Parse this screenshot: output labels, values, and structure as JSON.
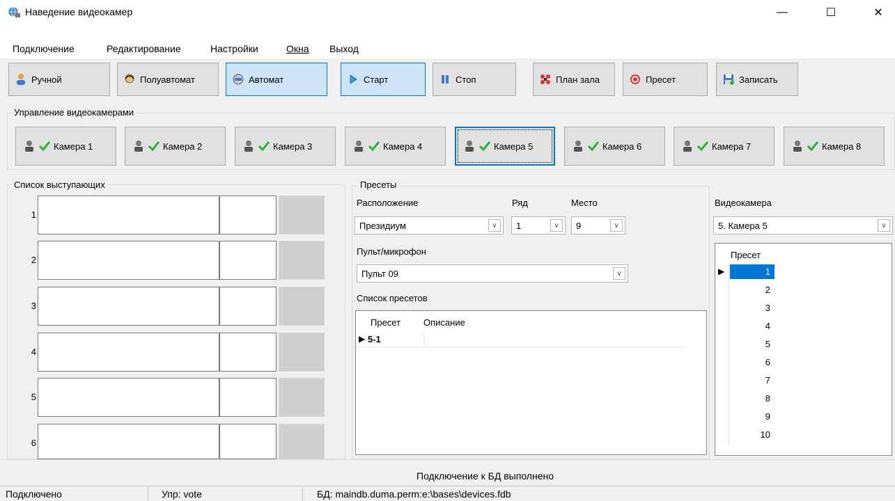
{
  "window": {
    "title": "Наведение видеокамер",
    "min_glyph": "—",
    "max_glyph": "☐",
    "close_glyph": "✕"
  },
  "menu": {
    "items": [
      "Подключение",
      "Редактирование",
      "Настройки",
      "Окна",
      "Выход"
    ]
  },
  "toolbar": {
    "manual": "Ручной",
    "semiauto": "Полуавтомат",
    "auto": "Автомат",
    "start": "Старт",
    "stop": "Стоп",
    "hall_plan": "План зала",
    "preset": "Пресет",
    "save": "Записать"
  },
  "cameras_group": {
    "title": "Управление видеокамерами",
    "cameras": [
      "Камера 1",
      "Камера 2",
      "Камера 3",
      "Камера 4",
      "Камера 5",
      "Камера 6",
      "Камера 7",
      "Камера 8"
    ],
    "selected": "Камера 5"
  },
  "speakers": {
    "title": "Список выступающих",
    "rows": [
      "1",
      "2",
      "3",
      "4",
      "5",
      "6"
    ]
  },
  "presets_group": {
    "title": "Пресеты",
    "location_label": "Расположение",
    "location_value": "Президиум",
    "row_label": "Ряд",
    "row_value": "1",
    "seat_label": "Место",
    "seat_value": "9",
    "console_label": "Пульт/микрофон",
    "console_value": "Пульт 09",
    "list_label": "Список пресетов",
    "list_col_preset": "Пресет",
    "list_col_desc": "Описание",
    "list_rows": [
      {
        "preset": "5-1",
        "desc": ""
      }
    ]
  },
  "camera_panel": {
    "label": "Видеокамера",
    "value": "5. Камера 5",
    "col_preset": "Пресет",
    "presets": [
      "1",
      "2",
      "3",
      "4",
      "5",
      "6",
      "7",
      "8",
      "9",
      "10"
    ],
    "selected_preset": "1"
  },
  "status": {
    "message": "Подключение к БД выполнено",
    "connection": "Подключено",
    "user": "Упр: vote",
    "db": "БД: maindb.duma.perm:e:\\bases\\devices.fdb"
  },
  "colors": {
    "accent": "#0078d7",
    "selected_bg": "#cce4f7",
    "check": "#2db32d"
  }
}
